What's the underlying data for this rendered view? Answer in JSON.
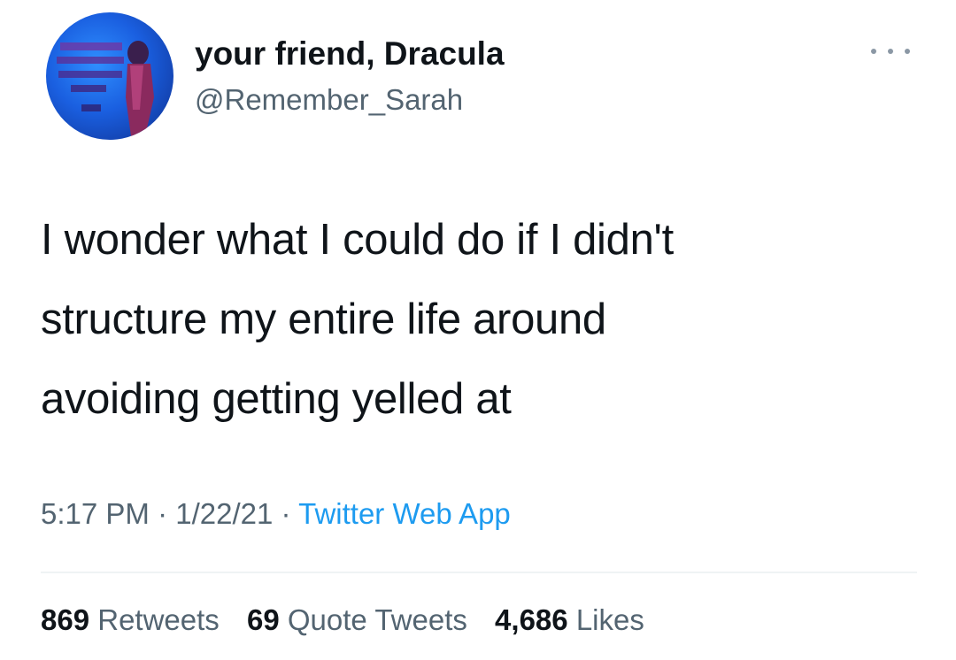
{
  "author": {
    "display_name": "your friend, Dracula",
    "handle": "@Remember_Sarah",
    "avatar_icon": "profile-avatar"
  },
  "tweet": {
    "lines": [
      "I wonder what I could do if I didn't",
      "structure my entire life around",
      "avoiding getting yelled at"
    ]
  },
  "meta": {
    "time": "5:17 PM",
    "date": "1/22/21",
    "separator": "·",
    "source": "Twitter Web App"
  },
  "stats": {
    "retweets_count": "869",
    "retweets_label": "Retweets",
    "quotes_count": "69",
    "quotes_label": "Quote Tweets",
    "likes_count": "4,686",
    "likes_label": "Likes"
  },
  "colors": {
    "text": "#0f1419",
    "secondary": "#536471",
    "link": "#1d9bf0",
    "divider": "#eff3f4"
  },
  "more_icon": "more-options-icon"
}
